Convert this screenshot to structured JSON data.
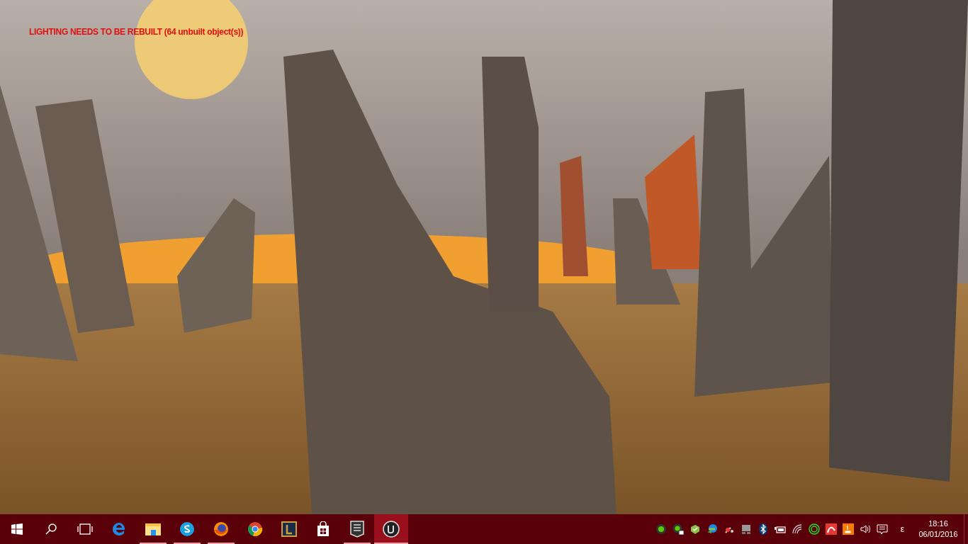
{
  "viewport": {
    "warning": "LIGHTING NEEDS TO BE REBUILT (64 unbuilt object(s))"
  },
  "taskbar": {
    "buttons": [
      {
        "kind": "start"
      },
      {
        "kind": "search"
      },
      {
        "kind": "taskview"
      }
    ],
    "apps": [
      {
        "kind": "edge",
        "running": false,
        "active": false
      },
      {
        "kind": "explorer",
        "running": true,
        "active": false
      },
      {
        "kind": "skype",
        "running": true,
        "active": false
      },
      {
        "kind": "firefox",
        "running": true,
        "active": false
      },
      {
        "kind": "chrome",
        "running": false,
        "active": false
      },
      {
        "kind": "league",
        "running": false,
        "active": false
      },
      {
        "kind": "store",
        "running": false,
        "active": false
      },
      {
        "kind": "epic",
        "running": true,
        "active": false
      },
      {
        "kind": "unreal",
        "running": true,
        "active": true
      }
    ],
    "tray": [
      {
        "kind": "green-dot"
      },
      {
        "kind": "green-dot-window"
      },
      {
        "kind": "leaf"
      },
      {
        "kind": "globe"
      },
      {
        "kind": "tool"
      },
      {
        "kind": "monitor"
      },
      {
        "kind": "bluetooth"
      },
      {
        "kind": "battery"
      },
      {
        "kind": "wifi"
      },
      {
        "kind": "ring"
      },
      {
        "kind": "antivirus"
      },
      {
        "kind": "java"
      },
      {
        "kind": "volume"
      },
      {
        "kind": "notification"
      }
    ],
    "input_indicator": "ε",
    "time": "18:16",
    "date": "06/01/2016"
  }
}
